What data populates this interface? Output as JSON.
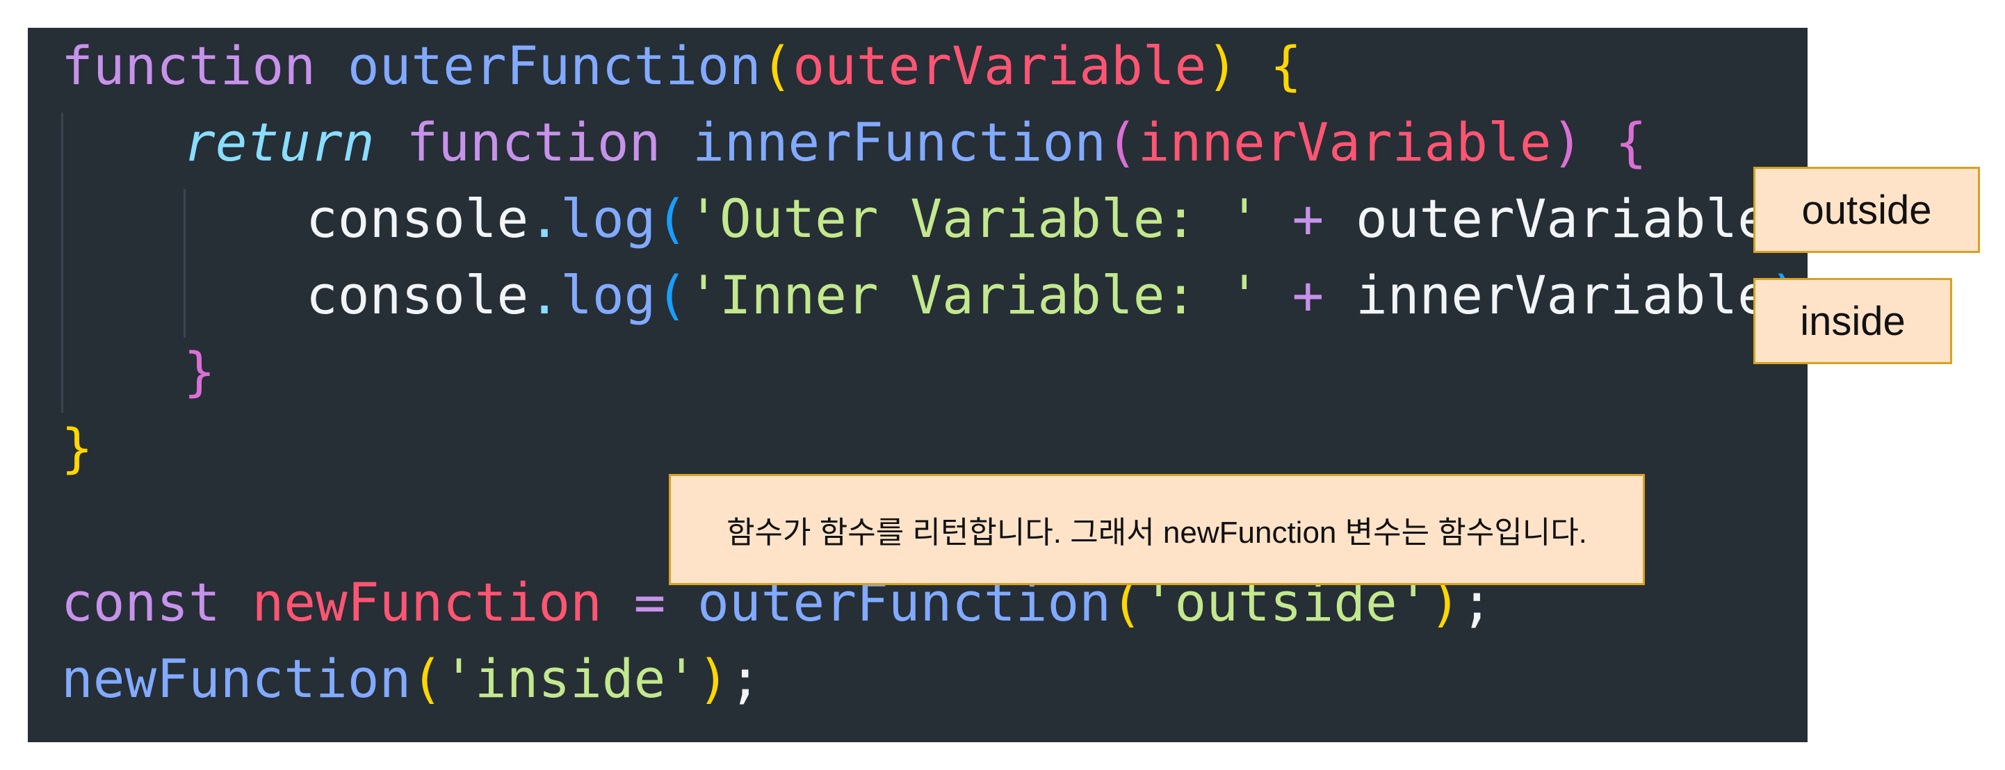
{
  "code": {
    "line1": {
      "kw": "function",
      "name": "outerFunction",
      "open": "(",
      "param": "outerVariable",
      "close": ")",
      "brace": "{"
    },
    "line2": {
      "ret": "return",
      "kw": "function",
      "name": "innerFunction",
      "open": "(",
      "param": "innerVariable",
      "close": ")",
      "brace": "{"
    },
    "line3": {
      "obj": "console",
      "dot": ".",
      "method": "log",
      "open": "(",
      "str": "'Outer Variable: '",
      "op": "+",
      "var": "outerVariable",
      "close": ")"
    },
    "line4": {
      "obj": "console",
      "dot": ".",
      "method": "log",
      "open": "(",
      "str": "'Inner Variable: '",
      "op": "+",
      "var": "innerVariable",
      "close": ")"
    },
    "line5": {
      "brace": "}"
    },
    "line6": {
      "brace": "}"
    },
    "line8": {
      "kw": "const",
      "var": "newFunction",
      "op": "=",
      "call": "outerFunction",
      "open": "(",
      "str": "'outside'",
      "close": ")",
      "semi": ";"
    },
    "line9": {
      "call": "newFunction",
      "open": "(",
      "str": "'inside'",
      "close": ")",
      "semi": ";"
    }
  },
  "callouts": {
    "outside": "outside",
    "inside": "inside",
    "note": "함수가 함수를 리턴합니다. 그래서 newFunction 변수는 함수입니다."
  },
  "colors": {
    "background": "#262e36",
    "keyword": "#c792ea",
    "function_name": "#82aaff",
    "parameter": "#ff5572",
    "string": "#c3e88d",
    "brace_yellow": "#ffd700",
    "brace_pink": "#da70d6",
    "brace_blue": "#179fff",
    "callout_fill": "#ffe3c8",
    "callout_border": "#d9a120"
  }
}
